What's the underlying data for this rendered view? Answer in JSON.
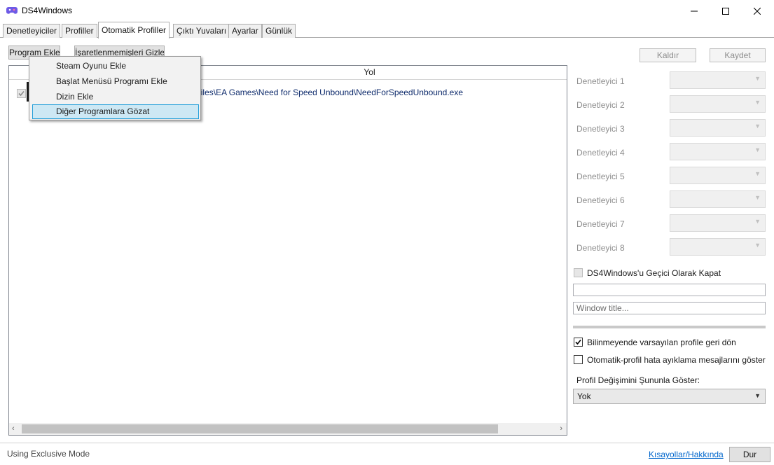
{
  "window": {
    "title": "DS4Windows",
    "app_icon": "gamepad-icon",
    "controls": [
      "minimize-icon",
      "maximize-icon",
      "close-icon"
    ]
  },
  "tabs": [
    {
      "label": "Denetleyiciler",
      "active": false
    },
    {
      "label": "Profiller",
      "active": false
    },
    {
      "label": "Otomatik Profiller",
      "active": true
    },
    {
      "label": "Çıktı Yuvaları",
      "active": false
    },
    {
      "label": "Ayarlar",
      "active": false
    },
    {
      "label": "Günlük",
      "active": false
    }
  ],
  "toolbar": {
    "add_program_label": "Program Ekle",
    "hide_unchecked_label": "İşaretlenmemişleri Gizle",
    "remove_label": "Kaldır",
    "save_label": "Kaydet"
  },
  "program_list": {
    "column_path": "Yol",
    "rows": [
      {
        "checked": true,
        "path_visible": "Files\\EA Games\\Need for Speed Unbound\\NeedForSpeedUnbound.exe"
      }
    ]
  },
  "add_menu": {
    "items": [
      {
        "label": "Steam Oyunu Ekle",
        "highlighted": false
      },
      {
        "label": "Başlat Menüsü Programı Ekle",
        "highlighted": false
      },
      {
        "label": "Dizin Ekle",
        "highlighted": false
      },
      {
        "label": "Diğer Programlara Gözat",
        "highlighted": true
      }
    ]
  },
  "controllers": [
    {
      "label": "Denetleyici 1",
      "value": ""
    },
    {
      "label": "Denetleyici 2",
      "value": ""
    },
    {
      "label": "Denetleyici 3",
      "value": ""
    },
    {
      "label": "Denetleyici 4",
      "value": ""
    },
    {
      "label": "Denetleyici 5",
      "value": ""
    },
    {
      "label": "Denetleyici 6",
      "value": ""
    },
    {
      "label": "Denetleyici 7",
      "value": ""
    },
    {
      "label": "Denetleyici 8",
      "value": ""
    }
  ],
  "options": {
    "temp_close_label": "DS4Windows'u Geçici Olarak Kapat",
    "temp_close_checked": false,
    "path_value": "",
    "window_title_placeholder": "Window title...",
    "revert_default_label": "Bilinmeyende varsayılan profile geri dön",
    "revert_default_checked": true,
    "debug_messages_label": "Otomatik-profil hata ayıklama mesajlarını göster",
    "debug_messages_checked": false,
    "show_switch_label": "Profil Değişimini Şununla Göster:",
    "show_switch_value": "Yok"
  },
  "status": {
    "mode_text": "Using Exclusive Mode",
    "shortcuts_link": "Kısayollar/Hakkında",
    "stop_label": "Dur"
  },
  "colors": {
    "accent_border": "#26a0da",
    "menu_highlight": "#cde8f4",
    "link": "#0066cc",
    "path_text": "#0d2a6b"
  }
}
